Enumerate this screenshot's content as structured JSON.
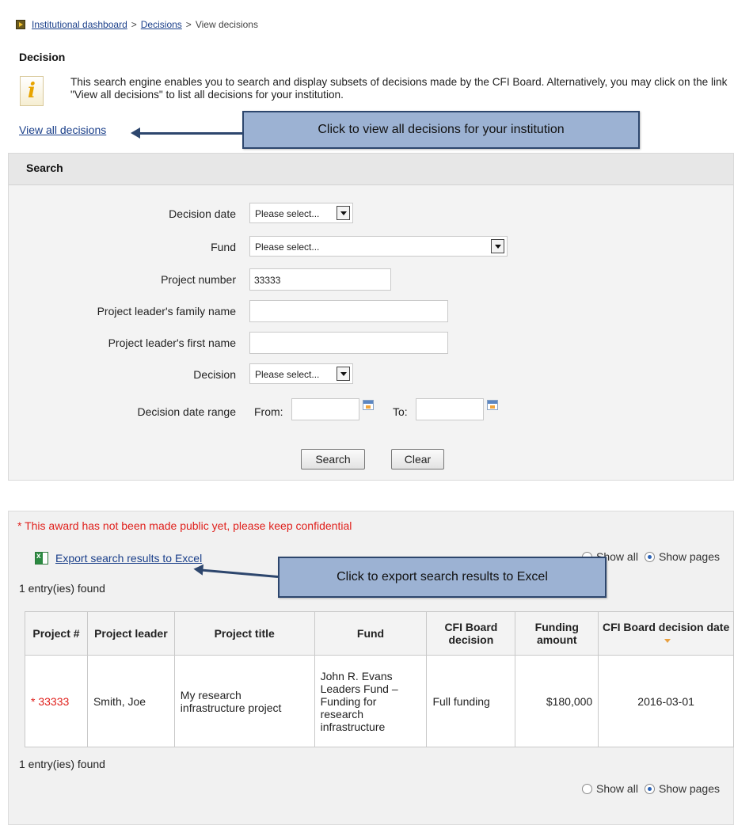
{
  "breadcrumb": {
    "items": [
      "Institutional dashboard",
      "Decisions"
    ],
    "current": "View decisions",
    "separator": ">"
  },
  "page_title": "Decision",
  "info": {
    "icon": "info-icon",
    "text": "This search engine enables you to search and display subsets of decisions made by the CFI Board. Alternatively, you may click on the link \"View all decisions\" to list all decisions for your institution."
  },
  "view_all_link": "View all decisions",
  "callouts": {
    "view_all": "Click to view all decisions for your institution",
    "export": "Click to export search results to Excel"
  },
  "search": {
    "header": "Search",
    "decision_date": {
      "label": "Decision date",
      "value": "Please select..."
    },
    "fund": {
      "label": "Fund",
      "value": "Please select..."
    },
    "project_number": {
      "label": "Project number",
      "value": "33333"
    },
    "family_name": {
      "label": "Project leader's family name",
      "value": ""
    },
    "first_name": {
      "label": "Project leader's first name",
      "value": ""
    },
    "decision": {
      "label": "Decision",
      "value": "Please select..."
    },
    "date_range": {
      "label": "Decision date range",
      "from_label": "From:",
      "to_label": "To:",
      "from_value": "",
      "to_value": ""
    },
    "search_button": "Search",
    "clear_button": "Clear"
  },
  "results": {
    "confidential_note": "* This award has not been made public yet, please keep confidential",
    "export_link": "Export search results to Excel",
    "count_top": "1 entry(ies) found",
    "count_bottom": "1 entry(ies) found",
    "view_options": {
      "show_all": "Show all",
      "show_pages": "Show pages",
      "selected": "show_pages"
    },
    "columns": [
      "Project #",
      "Project leader",
      "Project title",
      "Fund",
      "CFI Board decision",
      "Funding amount",
      "CFI Board decision date"
    ],
    "rows": [
      {
        "marker": "*",
        "project_number": "33333",
        "leader": "Smith, Joe",
        "title": "My research infrastructure project",
        "fund": "John R. Evans Leaders Fund – Funding for research infrastructure",
        "decision": "Full funding",
        "amount": "$180,000",
        "date": "2016-03-01"
      }
    ]
  },
  "colors": {
    "link": "#1a3f8a",
    "confidential": "#e0201c",
    "callout_fill": "#9cb2d3",
    "callout_border": "#2d466d",
    "panel_bg": "#f3f3f3"
  }
}
